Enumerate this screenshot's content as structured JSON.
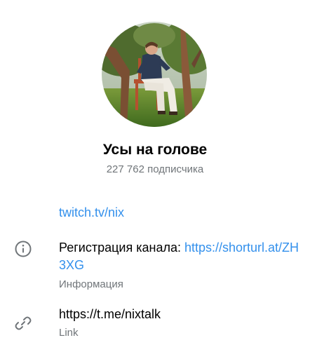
{
  "profile": {
    "title": "Усы на голове",
    "subscribers": "227 762 подписчика",
    "avatar_icon": "channel-avatar-photo"
  },
  "links": {
    "twitch": "twitch.tv/nix"
  },
  "description": {
    "prefix": "Регистрация канала: ",
    "url": "https://shorturl.at/ZH3XG",
    "label": "Информация",
    "icon": "info-icon"
  },
  "username": {
    "value": "https://t.me/nixtalk",
    "label": "Link",
    "icon": "link-icon"
  },
  "colors": {
    "link": "#3390ec",
    "secondary": "#707579",
    "icon": "#707579"
  }
}
